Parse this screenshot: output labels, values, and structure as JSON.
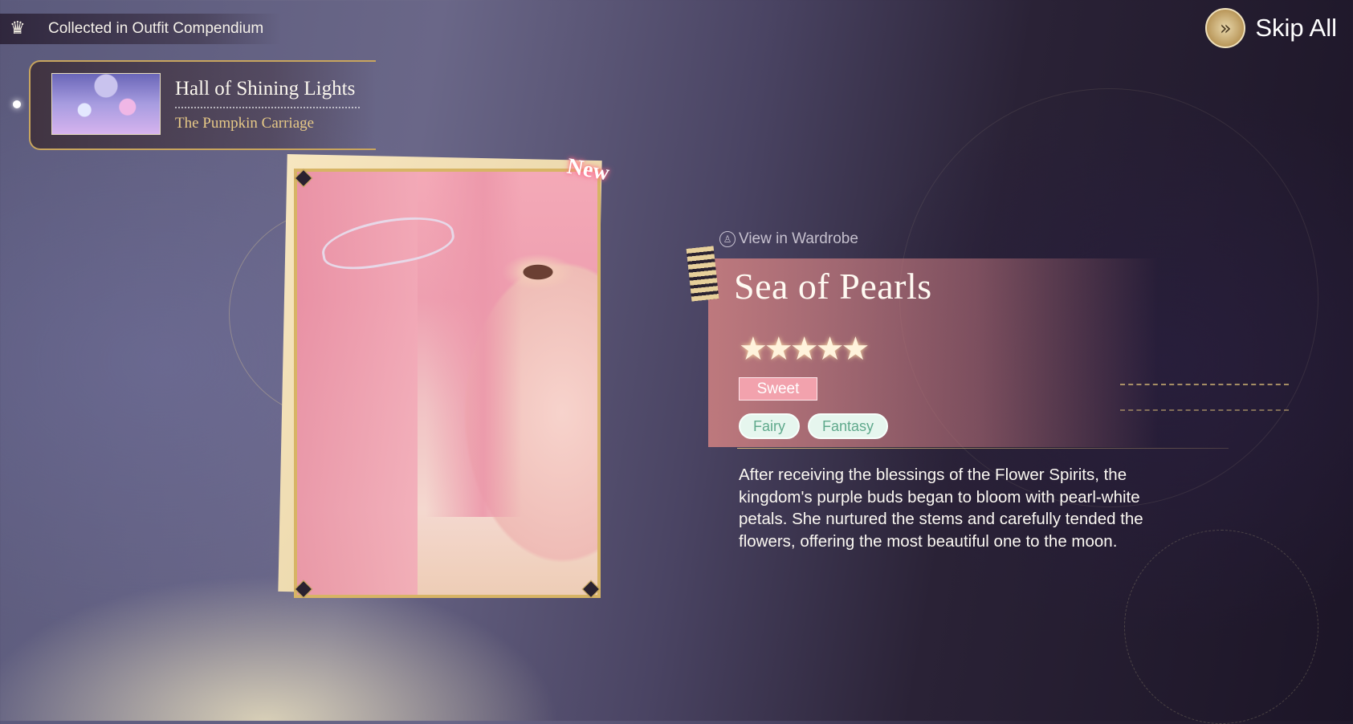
{
  "collected_banner": {
    "text": "Collected in Outfit Compendium",
    "icon": "outfit-icon"
  },
  "set_card": {
    "name": "Hall of Shining Lights",
    "subtitle": "The Pumpkin Carriage",
    "thumbnail": "set-thumbnail"
  },
  "skip": {
    "label": "Skip All",
    "icon": "double-chevron-right-icon"
  },
  "portrait": {
    "badge": "New"
  },
  "outfit": {
    "view_link": "View in Wardrobe",
    "title": "Sea of Pearls",
    "stars": "★★★★★",
    "rarity": 5,
    "style_tag": "Sweet",
    "tags": [
      "Fairy",
      "Fantasy"
    ],
    "description": "After receiving the blessings of the Flower Spirits, the kingdom's purple buds began to bloom with pearl-white petals. She nurtured the stems and carefully tended the flowers, offering the most beautiful one to the moon."
  },
  "colors": {
    "gold": "#d7b465",
    "panel_pink": "#d28282",
    "tag_mint": "#e6f6ee",
    "style_pink": "#f2a2ad"
  }
}
